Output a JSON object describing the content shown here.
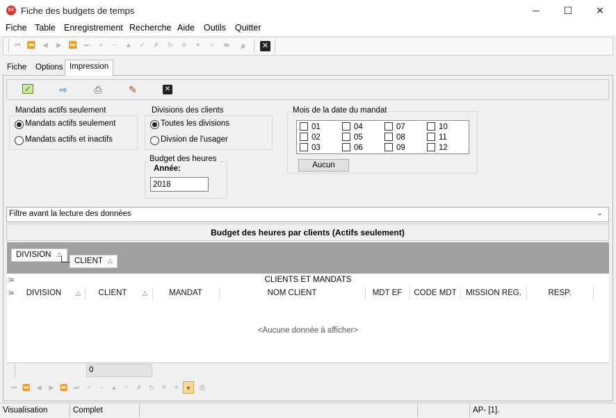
{
  "window": {
    "title": "Fiche des budgets de temps",
    "app_icon_text": "DX",
    "minimize": "─",
    "maximize": "☐",
    "close": "✕"
  },
  "menu": [
    "Fiche",
    "Table",
    "Enregistrement",
    "Recherche",
    "Aide",
    "Outils",
    "Quitter"
  ],
  "toolbar": {
    "icons": [
      "first-record-icon",
      "prev-page-icon",
      "prev-record-icon",
      "next-record-icon",
      "next-page-icon",
      "last-record-icon",
      "insert-icon",
      "delete-icon",
      "edit-icon",
      "post-icon",
      "cancel-icon",
      "refresh-icon",
      "asterisk-icon",
      "asterisk-multi-icon",
      "filter-icon",
      "binoculars-icon",
      "search-icon"
    ],
    "close_icon": "close-icon"
  },
  "tabs": [
    {
      "label": "Fiche"
    },
    {
      "label": "Options"
    },
    {
      "label": "Impression",
      "active": true
    }
  ],
  "actions": [
    "check-icon",
    "export-icon",
    "print-icon",
    "brush-icon",
    "close-icon"
  ],
  "mandats": {
    "title": "Mandats actifs seulement",
    "options": [
      {
        "label": "Mandats actifs seulement",
        "selected": true
      },
      {
        "label": "Mandats actifs et inactifs",
        "selected": false
      }
    ]
  },
  "divisions": {
    "title": "Divisions des clients",
    "options": [
      {
        "label": "Toutes les divisions",
        "selected": true
      },
      {
        "label": "Divsion de l'usager",
        "selected": false
      }
    ]
  },
  "budget": {
    "title": "Budget des heures",
    "year_label": "Année:",
    "year_value": "2018"
  },
  "mois": {
    "title": "Mois de la date du mandat",
    "months": [
      "01",
      "02",
      "03",
      "04",
      "05",
      "06",
      "07",
      "08",
      "09",
      "10",
      "11",
      "12"
    ],
    "none_button": "Aucun"
  },
  "filter": {
    "label": "Filtre avant la lecture des données"
  },
  "grid": {
    "title": "Budget des heures par clients (Actifs seulement)",
    "group_by": [
      "DIVISION",
      "CLIENT"
    ],
    "band_header": "CLIENTS ET MANDATS",
    "columns": [
      "DIVISION",
      "CLIENT",
      "MANDAT",
      "NOM CLIENT",
      "MDT EF",
      "CODE MDT",
      "MISSION REG.",
      "RESP."
    ],
    "empty_message": "<Aucune donnée à afficher>",
    "footer_count": "0"
  },
  "status": {
    "mode": "Visualisation",
    "state": "Complet",
    "right": "AP- [1]."
  }
}
